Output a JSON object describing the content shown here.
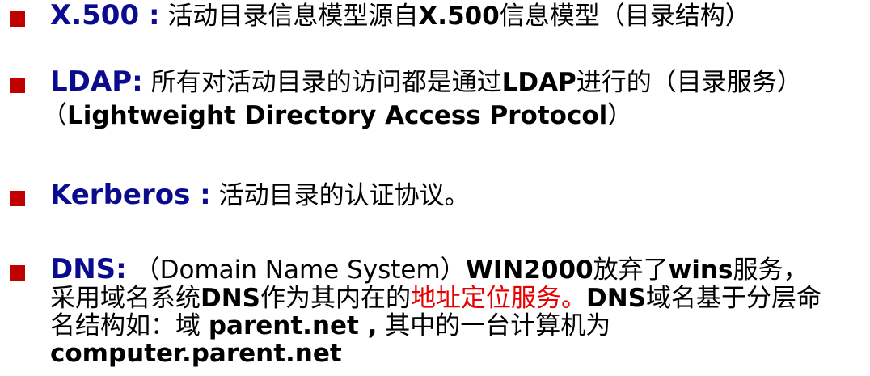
{
  "items": [
    {
      "term": "X.500 :",
      "lines": [
        [
          {
            "t": " 活动目录信息模型源自",
            "s": "n"
          },
          {
            "t": "X.500",
            "s": "b"
          },
          {
            "t": "信息模型（目录结构）",
            "s": "n"
          }
        ]
      ]
    },
    {
      "term": "LDAP:",
      "lines": [
        [
          {
            "t": " 所有对活动目录的访问都是通过",
            "s": "n"
          },
          {
            "t": "LDAP",
            "s": "b"
          },
          {
            "t": "进行的（目录服务）",
            "s": "n"
          }
        ],
        [
          {
            "t": "（",
            "s": "n"
          },
          {
            "t": "Lightweight Directory Access Protocol",
            "s": "b"
          },
          {
            "t": "）",
            "s": "n"
          }
        ]
      ]
    },
    {
      "term": "Kerberos :",
      "lines": [
        [
          {
            "t": "  活动目录的认证协议。",
            "s": "n"
          }
        ]
      ]
    },
    {
      "term": "DNS:",
      "lines": [
        [
          {
            "t": " （Domain Name System）",
            "s": "n"
          },
          {
            "t": "WIN2000",
            "s": "b"
          },
          {
            "t": "放弃了",
            "s": "n"
          },
          {
            "t": "wins",
            "s": "b"
          },
          {
            "t": "服务，",
            "s": "n"
          }
        ],
        [
          {
            "t": "采用域名系统",
            "s": "n"
          },
          {
            "t": "DNS",
            "s": "b"
          },
          {
            "t": "作为其内在的",
            "s": "n"
          },
          {
            "t": "地址定位服务。",
            "s": "r"
          },
          {
            "t": "DNS",
            "s": "b"
          },
          {
            "t": "域名基于分层命",
            "s": "n"
          }
        ],
        [
          {
            "t": "名结构如：域 ",
            "s": "n"
          },
          {
            "t": "parent.net ,",
            "s": "b"
          },
          {
            "t": " 其中的一台计算机为",
            "s": "n"
          }
        ],
        [
          {
            "t": "computer.parent.net",
            "s": "b"
          }
        ]
      ]
    }
  ],
  "colors": {
    "bullet": "#c00000",
    "term": "#0b0b8f",
    "highlight": "#e60000"
  }
}
